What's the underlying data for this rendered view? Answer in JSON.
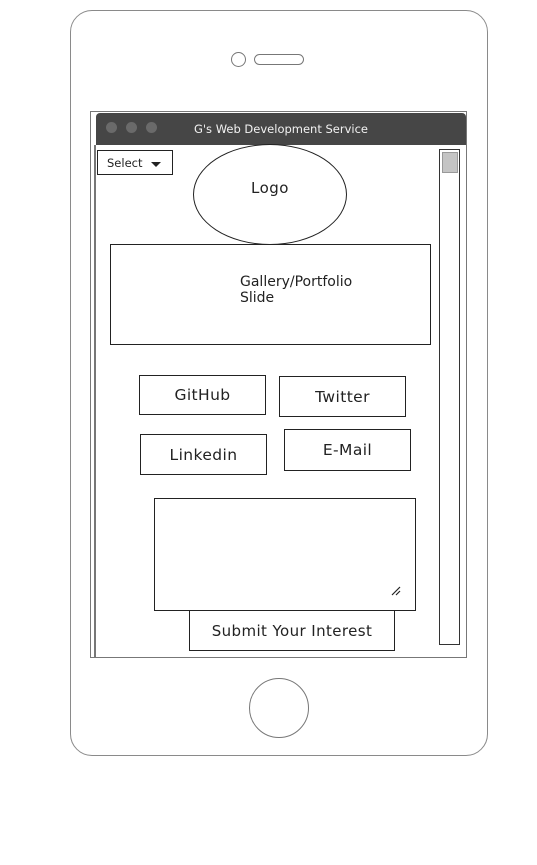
{
  "window": {
    "title": "G's Web Development Service"
  },
  "nav": {
    "select_label": "Select"
  },
  "logo": {
    "label": "Logo"
  },
  "gallery": {
    "label": "Gallery/Portfolio Slide"
  },
  "links": {
    "github": "GitHub",
    "twitter": "Twitter",
    "linkedin": "Linkedin",
    "email": "E-Mail"
  },
  "form": {
    "message_value": "",
    "submit_label": "Submit Your Interest"
  }
}
